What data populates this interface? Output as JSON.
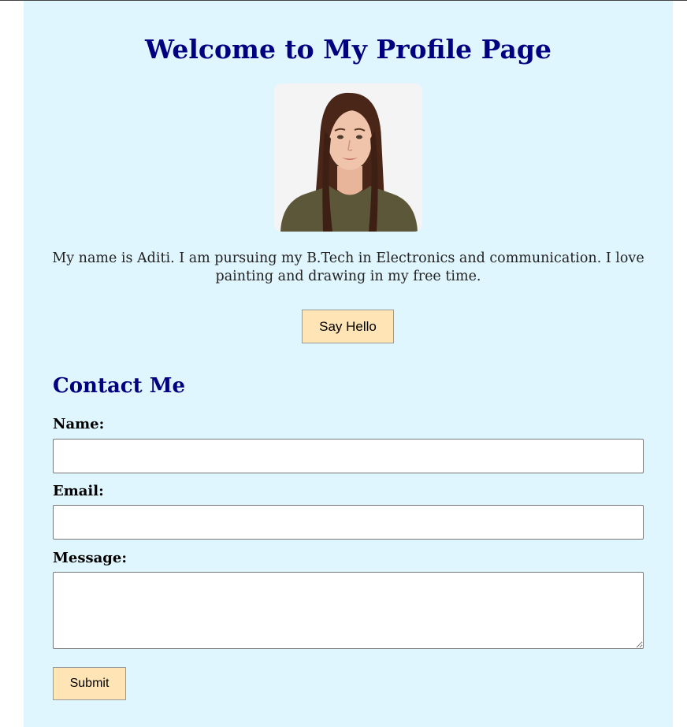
{
  "header": {
    "title": "Welcome to My Profile Page"
  },
  "profile": {
    "photo": "profile-photo",
    "bio": "My name is Aditi. I am pursuing my B.Tech in Electronics and communication. I love painting and drawing in my free time.",
    "button_label": "Say Hello"
  },
  "contact": {
    "heading": "Contact Me",
    "name_label": "Name:",
    "name_value": "",
    "email_label": "Email:",
    "email_value": "",
    "message_label": "Message:",
    "message_value": "",
    "submit_label": "Submit"
  },
  "colors": {
    "background": "#e0f6fe",
    "heading": "#000080",
    "button": "#ffe4b5"
  }
}
